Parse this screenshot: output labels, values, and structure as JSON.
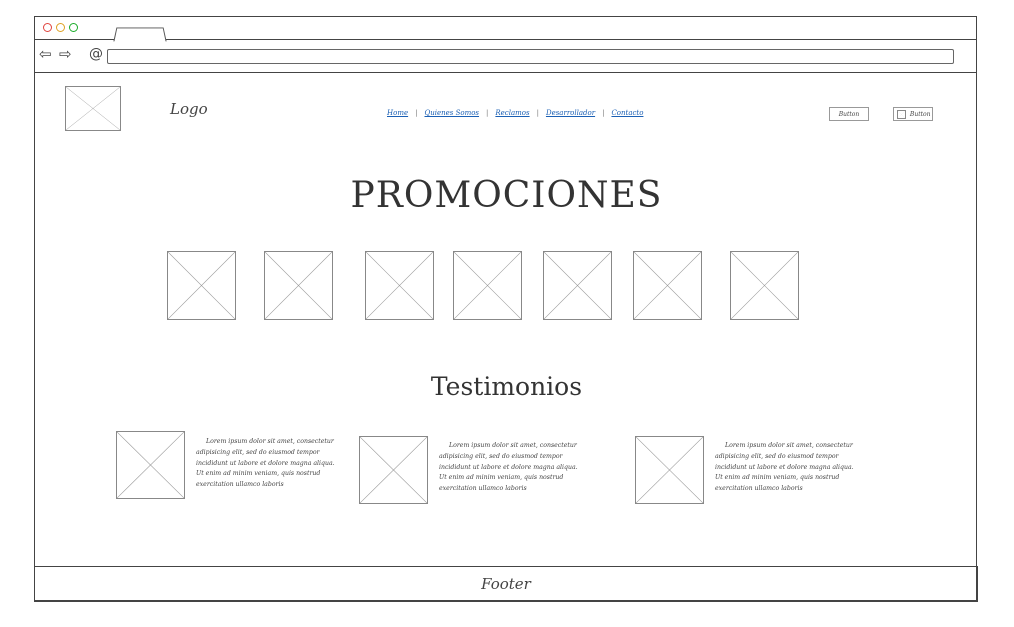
{
  "header": {
    "logo_text": "Logo",
    "nav": [
      "Home",
      "Quienes Somos",
      "Reclamos",
      "Desarrollador",
      "Contacto"
    ],
    "button1": "Button",
    "button2": "Button"
  },
  "promotions": {
    "title": "PROMOCIONES",
    "item_count": 7
  },
  "testimonials": {
    "title": "Testimonios",
    "items": [
      {
        "text": "Lorem ipsum dolor sit amet, consectetur adipisicing elit, sed do eiusmod tempor incididunt ut labore et dolore magna aliqua. Ut enim ad minim veniam, quis nostrud exercitation ullamco laboris"
      },
      {
        "text": "Lorem ipsum dolor sit amet, consectetur adipisicing elit, sed do eiusmod tempor incididunt ut labore et dolore magna aliqua. Ut enim ad minim veniam, quis nostrud exercitation ullamco laboris"
      },
      {
        "text": "Lorem ipsum dolor sit amet, consectetur adipisicing elit, sed do eiusmod tempor incididunt ut labore et dolore magna aliqua. Ut enim ad minim veniam, quis nostrud exercitation ullamco laboris"
      }
    ]
  },
  "footer": {
    "text": "Footer"
  },
  "icons": {
    "back": "back-arrow-icon",
    "forward": "forward-arrow-icon",
    "at": "at-sign-icon"
  },
  "colors": {
    "window_dot_close": "#e0443e",
    "window_dot_min": "#dea123",
    "window_dot_max": "#1aab29",
    "link": "#1a5fb4"
  }
}
